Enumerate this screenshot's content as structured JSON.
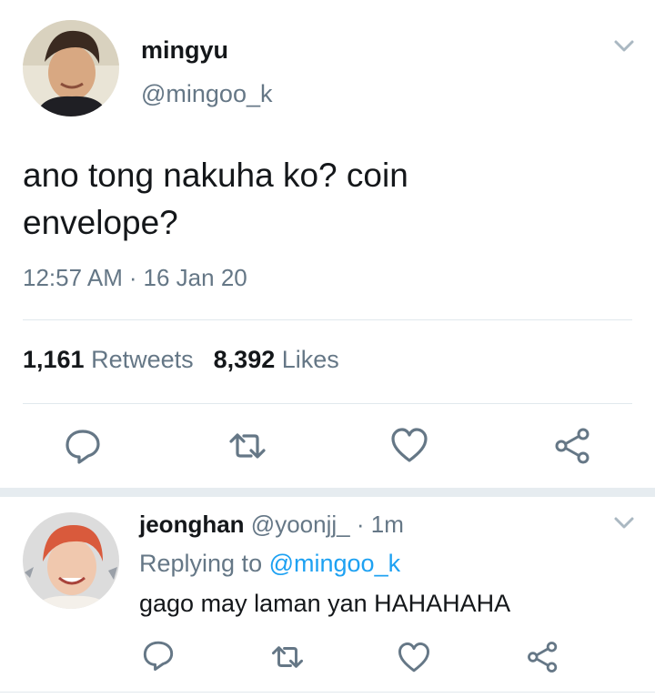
{
  "tweet": {
    "author_name": "mingyu",
    "author_handle": "@mingoo_k",
    "text": "ano tong nakuha ko? coin\nenvelope?",
    "time": "12:57 AM",
    "separator": "·",
    "date": "16 Jan 20",
    "retweets_count": "1,161",
    "retweets_label": "Retweets",
    "likes_count": "8,392",
    "likes_label": "Likes",
    "menu_icon": "chevron-down-icon",
    "actions": [
      "reply-icon",
      "retweet-icon",
      "like-icon",
      "share-icon"
    ]
  },
  "reply": {
    "author_name": "jeonghan",
    "author_handle": "@yoonjj_",
    "separator": "·",
    "time": "1m",
    "replying_prefix": "Replying to",
    "replying_mention": "@mingoo_k",
    "text": "gago may laman yan HAHAHAHA",
    "menu_icon": "chevron-down-icon",
    "actions": [
      "reply-icon",
      "retweet-icon",
      "like-icon",
      "share-icon"
    ]
  },
  "colors": {
    "text": "#14171a",
    "secondary": "#657786",
    "accent": "#1da1f2",
    "divider": "#e1e8ed",
    "band": "#e6ecf0"
  }
}
